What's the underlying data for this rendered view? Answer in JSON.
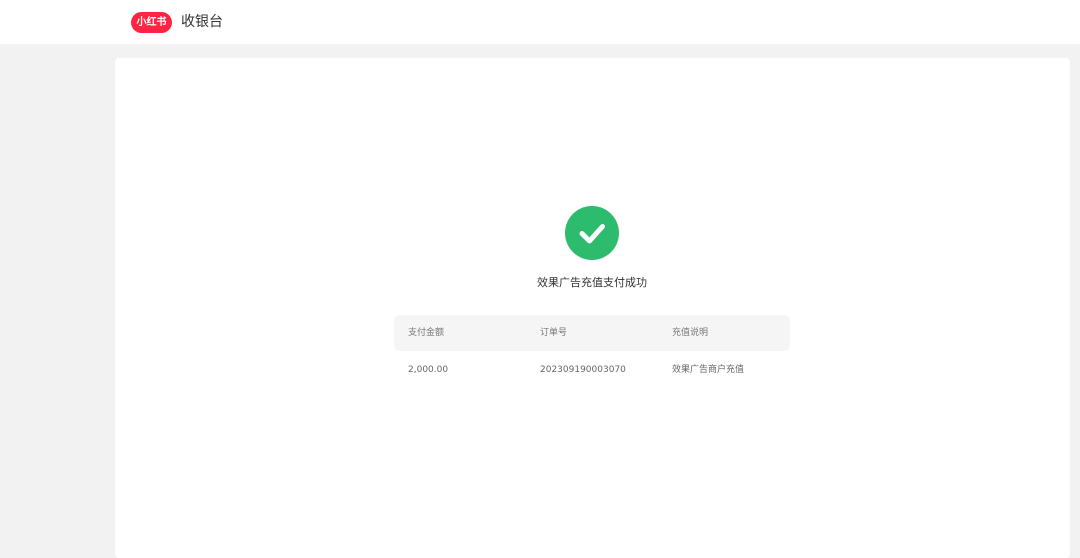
{
  "header": {
    "logo_text": "小红书",
    "title": "收银台"
  },
  "result": {
    "icon": "check-circle-icon",
    "message": "效果广告充值支付成功"
  },
  "table": {
    "columns": [
      "支付金额",
      "订单号",
      "充值说明"
    ],
    "rows": [
      [
        "2,000.00",
        "202309190003070",
        "效果广告商户充值"
      ]
    ]
  },
  "colors": {
    "brand": "#ff2442",
    "success": "#2dbb6d",
    "page_background": "#f2f2f2"
  }
}
